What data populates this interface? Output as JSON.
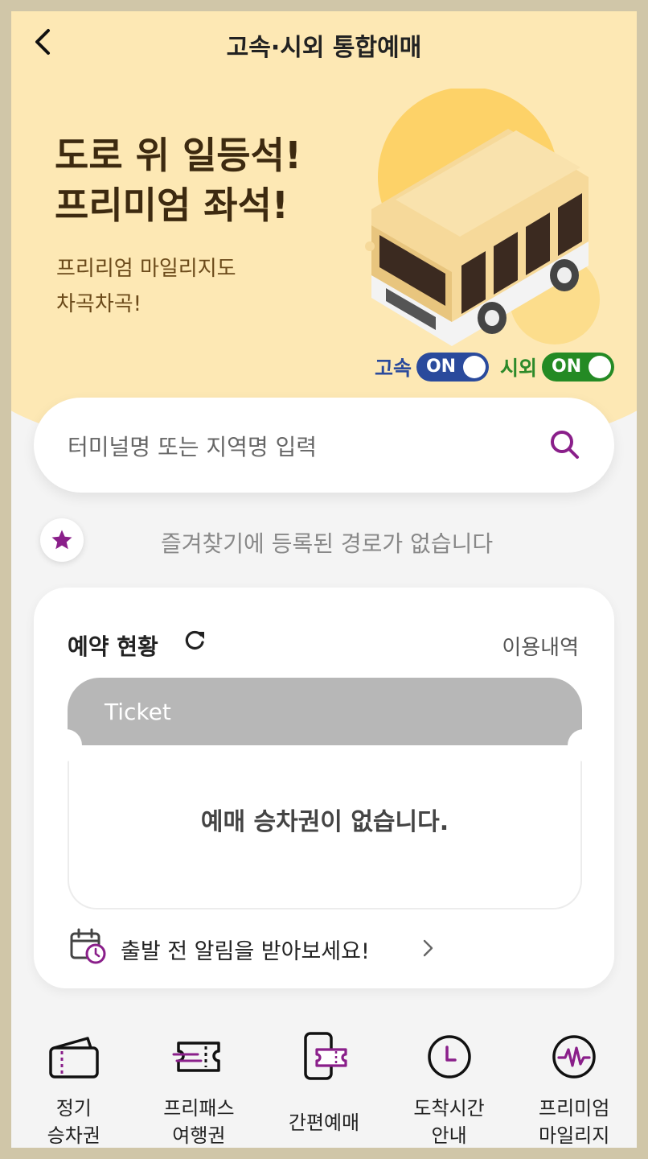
{
  "header": {
    "title": "고속·시외 통합예매"
  },
  "banner": {
    "headline_1": "도로 위 일등석!",
    "headline_2": "프리미엄 좌석!",
    "sub_1": "프리리엄 마일리지도",
    "sub_2": "차곡차곡!"
  },
  "toggles": {
    "express_label": "고속",
    "express_state": "ON",
    "intercity_label": "시외",
    "intercity_state": "ON",
    "express_color": "#2a4a9c",
    "intercity_color": "#248a24"
  },
  "search": {
    "placeholder": "터미널명 또는 지역명 입력"
  },
  "favorites": {
    "empty_text": "즐겨찾기에 등록된 경로가 없습니다"
  },
  "reservation": {
    "title": "예약 현황",
    "history_link": "이용내역",
    "ticket_header": "Ticket",
    "empty_text": "예매 승차권이 없습니다.",
    "alarm_text": "출발 전 알림을 받아보세요!"
  },
  "quick_menu": [
    {
      "label": "정기\n승차권",
      "icon": "commuter-pass-icon"
    },
    {
      "label": "프리패스\n여행권",
      "icon": "free-pass-icon"
    },
    {
      "label": "간편예매",
      "icon": "quick-booking-icon"
    },
    {
      "label": "도착시간\n안내",
      "icon": "arrival-time-icon"
    },
    {
      "label": "프리미엄\n마일리지",
      "icon": "premium-mileage-icon"
    }
  ],
  "colors": {
    "accent_purple": "#8a1f8a",
    "banner_bg": "#fde8b4"
  }
}
